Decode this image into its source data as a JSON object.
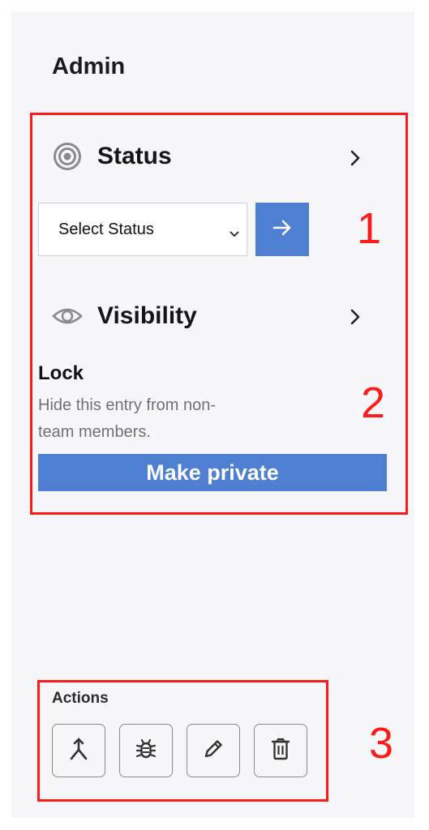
{
  "admin": {
    "title": "Admin"
  },
  "status": {
    "heading": "Status",
    "icon": "target-icon",
    "select": {
      "value": "Select Status"
    },
    "submit_icon": "arrow-right-icon"
  },
  "visibility": {
    "heading": "Visibility",
    "icon": "eye-icon",
    "lock_title": "Lock",
    "lock_description": "Hide this entry from non-team members.",
    "private_button": "Make private"
  },
  "actions": {
    "title": "Actions",
    "buttons": [
      {
        "icon": "merge-icon"
      },
      {
        "icon": "bug-icon"
      },
      {
        "icon": "pencil-icon"
      },
      {
        "icon": "trash-icon"
      }
    ]
  },
  "annotations": [
    "1",
    "2",
    "3"
  ],
  "colors": {
    "accent": "#4f7fd1",
    "annotation": "#ff1a1a",
    "panel": "#f7f7fa"
  }
}
